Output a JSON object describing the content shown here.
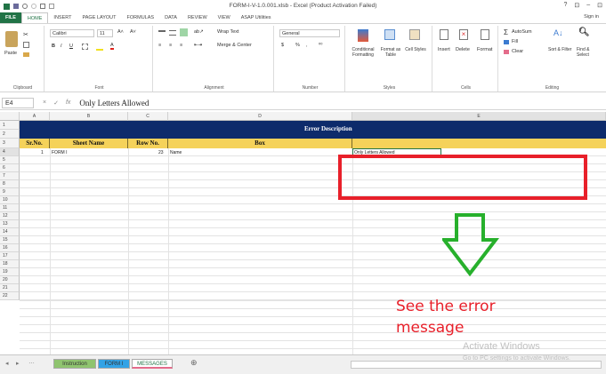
{
  "window": {
    "title": "FORM-I-V-1.0.001.xlsb - Excel (Product Activation Failed)",
    "controls": [
      "?",
      "⊡",
      "–",
      "⊡"
    ]
  },
  "ribbon_tabs": [
    "FILE",
    "HOME",
    "INSERT",
    "PAGE LAYOUT",
    "FORMULAS",
    "DATA",
    "REVIEW",
    "VIEW",
    "ASAP Utilities"
  ],
  "active_tab": "HOME",
  "sign_in": "Sign in",
  "ribbon": {
    "clipboard": {
      "label": "Clipboard",
      "paste": "Paste"
    },
    "font": {
      "label": "Font",
      "name": "Calibri",
      "size": "11",
      "bold": "B",
      "italic": "I",
      "underline": "U"
    },
    "alignment": {
      "label": "Alignment",
      "wrap": "Wrap Text",
      "merge": "Merge & Center"
    },
    "number": {
      "label": "Number",
      "format": "General",
      "currency": "$",
      "percent": "%",
      "comma": ","
    },
    "styles": {
      "label": "Styles",
      "conditional": "Conditional Formatting",
      "format_table": "Format as Table",
      "cell_styles": "Cell Styles"
    },
    "cells": {
      "label": "Cells",
      "insert": "Insert",
      "delete": "Delete",
      "format": "Format"
    },
    "editing": {
      "label": "Editing",
      "autosum": "AutoSum",
      "fill": "Fill",
      "clear": "Clear",
      "sort": "Sort & Filter",
      "find": "Find & Select"
    }
  },
  "formula_bar": {
    "name_box": "E4",
    "formula": "Only Letters Allowed"
  },
  "columns": [
    "A",
    "B",
    "C",
    "D",
    "E"
  ],
  "rows": [
    "1",
    "2",
    "3",
    "4",
    "5",
    "6",
    "7",
    "8",
    "9",
    "10",
    "11",
    "12",
    "13",
    "14",
    "15",
    "16",
    "17",
    "18",
    "19",
    "20",
    "21",
    "22"
  ],
  "sheet": {
    "banner": "Error Description",
    "headers": [
      "Sr.No.",
      "Sheet Name",
      "Row No.",
      "Box",
      ""
    ],
    "data_row": {
      "sr": "1",
      "sheet": "FORM I",
      "row": "23",
      "box": "Name",
      "error": "Only Letters Allowed"
    }
  },
  "sheet_tabs": [
    "Instruction",
    "FORM I",
    "MESSAGES"
  ],
  "active_sheet": "MESSAGES",
  "annotation": {
    "line1": "See the error",
    "line2": "message"
  },
  "watermark": {
    "line1": "Activate Windows",
    "line2": "Go to PC settings to activate Windows."
  },
  "colors": {
    "excel_green": "#217346",
    "navy": "#0d2b6b",
    "header_yellow": "#f5d25a",
    "red": "#e8202a",
    "arrow_green": "#27b02c",
    "tab_green": "#8fc46f",
    "tab_blue": "#33a3e6"
  }
}
